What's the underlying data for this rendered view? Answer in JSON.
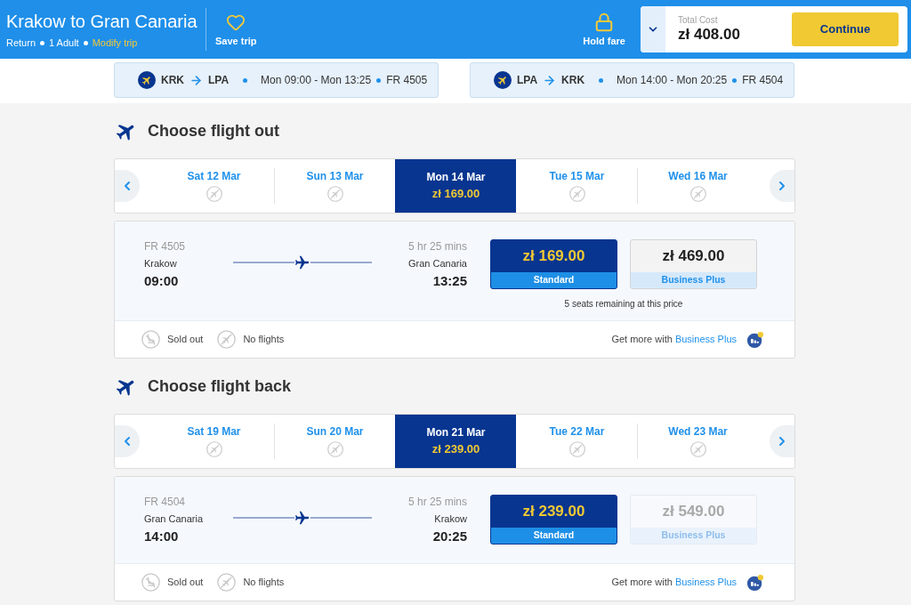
{
  "header": {
    "title": "Krakow to Gran Canaria",
    "trip_type": "Return",
    "passengers": "1 Adult",
    "modify_link": "Modify trip",
    "save_trip": "Save trip",
    "hold_fare": "Hold fare",
    "total_cost": {
      "label": "Total Cost",
      "amount": "zł 408.00"
    },
    "continue_button": "Continue"
  },
  "route_summaries": [
    {
      "origin": "KRK",
      "destination": "LPA",
      "times": "Mon 09:00 - Mon 13:25",
      "flight_number": "FR 4505"
    },
    {
      "origin": "LPA",
      "destination": "KRK",
      "times": "Mon 14:00 - Mon 20:25",
      "flight_number": "FR 4504"
    }
  ],
  "sections": [
    {
      "title": "Choose flight out",
      "dates": [
        {
          "kind": "no_flights",
          "label": "Sat 12 Mar",
          "selected": false
        },
        {
          "kind": "no_flights",
          "label": "Sun 13 Mar",
          "selected": false
        },
        {
          "kind": "fare",
          "label": "Mon 14 Mar",
          "price": "zł 169.00",
          "selected": true
        },
        {
          "kind": "no_flights",
          "label": "Tue 15 Mar",
          "selected": false
        },
        {
          "kind": "no_flights",
          "label": "Wed 16 Mar",
          "selected": false
        }
      ],
      "flight": {
        "flight_number": "FR 4505",
        "duration": "5 hr 25 mins",
        "origin": "Krakow",
        "departure": "09:00",
        "destination": "Gran Canaria",
        "arrival": "13:25"
      },
      "fares": [
        {
          "price": "zł 169.00",
          "name": "Standard",
          "selected": true,
          "disabled": false
        },
        {
          "price": "zł 469.00",
          "name": "Business Plus",
          "selected": false,
          "disabled": false
        }
      ],
      "seats_note": "5 seats remaining at this price",
      "legend": [
        {
          "kind": "sold_out",
          "label": "Sold out"
        },
        {
          "kind": "no_flights",
          "label": "No flights"
        }
      ],
      "upsell": {
        "text": "Get more with",
        "link": "Business Plus"
      }
    },
    {
      "title": "Choose flight back",
      "dates": [
        {
          "kind": "no_flights",
          "label": "Sat 19 Mar",
          "selected": false
        },
        {
          "kind": "no_flights",
          "label": "Sun 20 Mar",
          "selected": false
        },
        {
          "kind": "fare",
          "label": "Mon 21 Mar",
          "price": "zł 239.00",
          "selected": true
        },
        {
          "kind": "no_flights",
          "label": "Tue 22 Mar",
          "selected": false
        },
        {
          "kind": "no_flights",
          "label": "Wed 23 Mar",
          "selected": false
        }
      ],
      "flight": {
        "flight_number": "FR 4504",
        "duration": "5 hr 25 mins",
        "origin": "Gran Canaria",
        "departure": "14:00",
        "destination": "Krakow",
        "arrival": "20:25"
      },
      "fares": [
        {
          "price": "zł 239.00",
          "name": "Standard",
          "selected": true,
          "disabled": false
        },
        {
          "price": "zł 549.00",
          "name": "Business Plus",
          "selected": false,
          "disabled": true
        }
      ],
      "legend": [
        {
          "kind": "sold_out",
          "label": "Sold out"
        },
        {
          "kind": "no_flights",
          "label": "No flights"
        }
      ],
      "upsell": {
        "text": "Get more with",
        "link": "Business Plus"
      }
    }
  ]
}
